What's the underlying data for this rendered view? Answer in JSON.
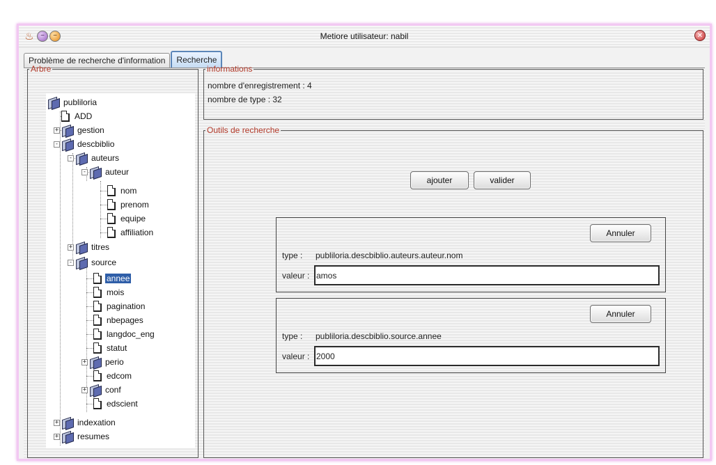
{
  "window": {
    "title": "Metiore utilisateur: nabil"
  },
  "tabs": [
    {
      "label": "Problème de recherche d'information",
      "active": false
    },
    {
      "label": "Recherche",
      "active": true
    }
  ],
  "tree_panel": {
    "legend": "Arbre",
    "items": [
      {
        "label": "publiloria",
        "kind": "folder",
        "selected": false
      },
      {
        "label": "ADD",
        "kind": "file",
        "selected": false
      },
      {
        "label": "gestion",
        "kind": "folder",
        "expander": "+",
        "selected": false
      },
      {
        "label": "descbiblio",
        "kind": "folder",
        "expander": "-",
        "selected": false
      },
      {
        "label": "auteurs",
        "kind": "folder",
        "expander": "-",
        "selected": false
      },
      {
        "label": "auteur",
        "kind": "folder",
        "expander": "-",
        "selected": false
      },
      {
        "label": "nom",
        "kind": "file",
        "selected": false
      },
      {
        "label": "prenom",
        "kind": "file",
        "selected": false
      },
      {
        "label": "equipe",
        "kind": "file",
        "selected": false
      },
      {
        "label": "affiliation",
        "kind": "file",
        "selected": false
      },
      {
        "label": "titres",
        "kind": "folder",
        "expander": "+",
        "selected": false
      },
      {
        "label": "source",
        "kind": "folder",
        "expander": "-",
        "selected": false
      },
      {
        "label": "annee",
        "kind": "file",
        "selected": true
      },
      {
        "label": "mois",
        "kind": "file",
        "selected": false
      },
      {
        "label": "pagination",
        "kind": "file",
        "selected": false
      },
      {
        "label": "nbepages",
        "kind": "file",
        "selected": false
      },
      {
        "label": "langdoc_eng",
        "kind": "file",
        "selected": false
      },
      {
        "label": "statut",
        "kind": "file",
        "selected": false
      },
      {
        "label": "perio",
        "kind": "folder",
        "expander": "+",
        "selected": false
      },
      {
        "label": "edcom",
        "kind": "file",
        "selected": false
      },
      {
        "label": "conf",
        "kind": "folder",
        "expander": "+",
        "selected": false
      },
      {
        "label": "edscient",
        "kind": "file",
        "selected": false
      },
      {
        "label": "indexation",
        "kind": "folder",
        "expander": "+",
        "selected": false
      },
      {
        "label": "resumes",
        "kind": "folder",
        "expander": "+",
        "selected": false
      }
    ]
  },
  "informations": {
    "legend": "informations",
    "records_line": "nombre d'enregistrement : 4",
    "types_line": "nombre de type : 32"
  },
  "search_tools": {
    "legend": "Outils de recherche",
    "add_label": "ajouter",
    "validate_label": "valider",
    "criteria": [
      {
        "cancel_label": "Annuler",
        "type_label": "type :",
        "type_value": "publiloria.descbiblio.auteurs.auteur.nom",
        "value_label": "valeur :",
        "value": "amos"
      },
      {
        "cancel_label": "Annuler",
        "type_label": "type :",
        "type_value": "publiloria.descbiblio.source.annee",
        "value_label": "valeur :",
        "value": "2000"
      }
    ]
  },
  "colors": {
    "legend_text": "#b33a2a",
    "selection": "#2f5ea8",
    "window_border": "#f2c8f2",
    "active_tab": "#c6dcf3"
  },
  "icons": {
    "app": "java-icon",
    "minimize": "purple-circle-icon",
    "maximize": "orange-circle-icon",
    "close": "close-icon",
    "folder": "folder-icon",
    "file": "file-icon"
  }
}
